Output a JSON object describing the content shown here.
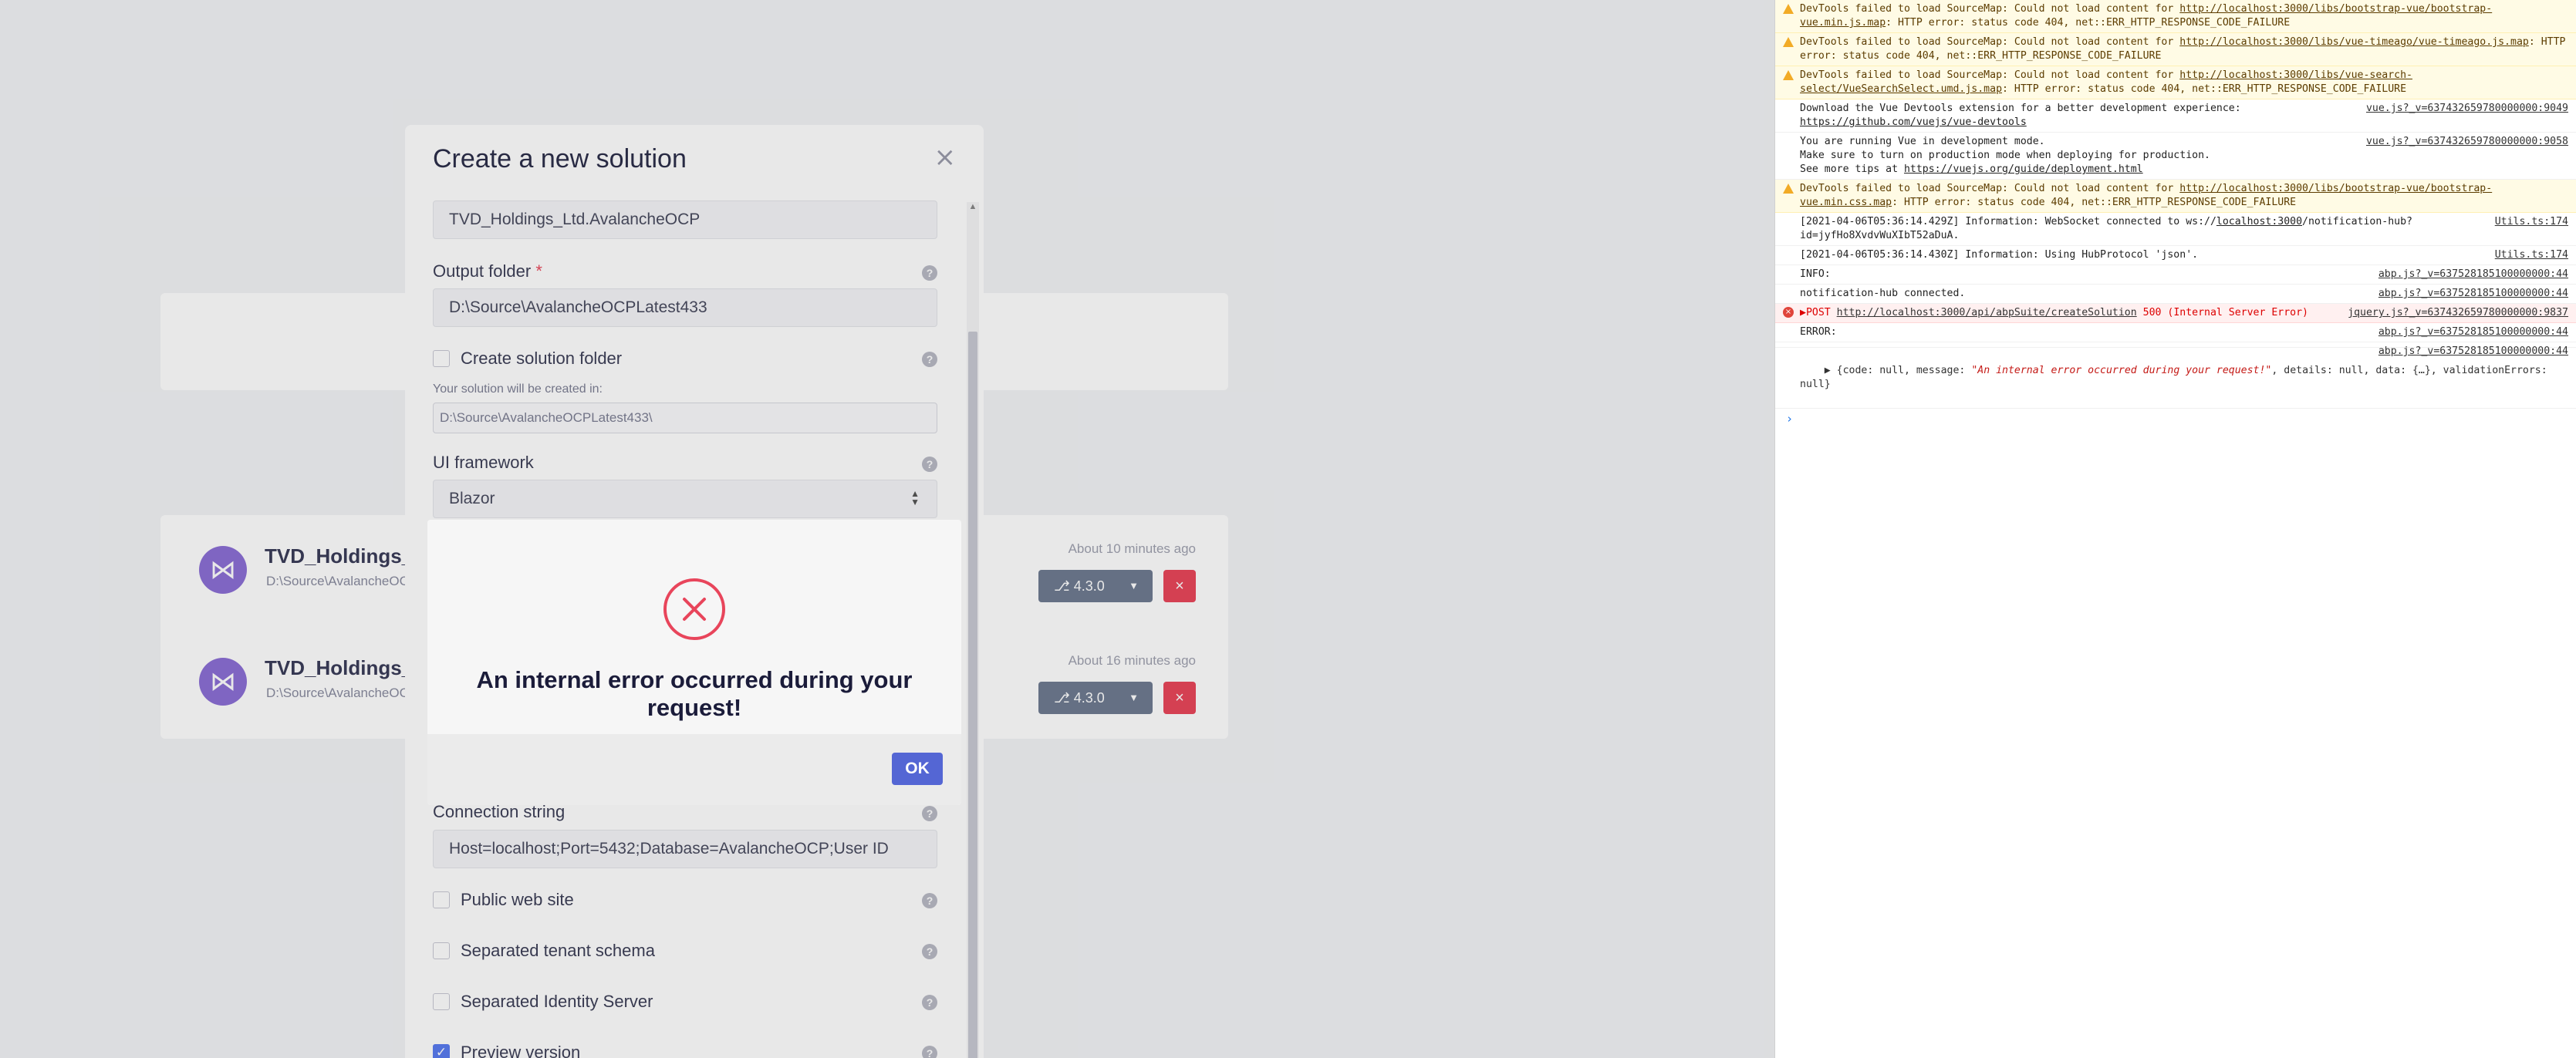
{
  "app": {
    "solutions": [
      {
        "name": "TVD_Holdings_L",
        "path": "D:\\Source\\AvalancheOC",
        "time": "About 10 minutes ago",
        "version": "4.3.0"
      },
      {
        "name": "TVD_Holdings_L",
        "path": "D:\\Source\\AvalancheOC",
        "time": "About 16 minutes ago",
        "version": "4.3.0"
      }
    ],
    "create_modal": {
      "title": "Create a new solution",
      "close": "×",
      "solution_name_value": "TVD_Holdings_Ltd.AvalancheOCP",
      "output_folder_label": "Output folder",
      "required_mark": "*",
      "output_folder_value": "D:\\Source\\AvalancheOCPLatest433",
      "create_solution_folder_label": "Create solution folder",
      "created_in_hint": "Your solution will be created in:",
      "created_in_path": "D:\\Source\\AvalancheOCPLatest433\\",
      "ui_framework_label": "UI framework",
      "ui_framework_value": "Blazor",
      "connection_string_label": "Connection string",
      "connection_string_value": "Host=localhost;Port=5432;Database=AvalancheOCP;User ID",
      "public_web_site_label": "Public web site",
      "separated_tenant_schema_label": "Separated tenant schema",
      "separated_identity_server_label": "Separated Identity Server",
      "preview_version_label": "Preview version",
      "help": "?"
    },
    "error_dialog": {
      "message": "An internal error occurred during your request!",
      "ok_label": "OK"
    }
  },
  "console": {
    "messages": [
      {
        "level": "warn",
        "text": "DevTools failed to load SourceMap: Could not load content for ",
        "link": "http://localhost:3000/libs/bootstrap-vue/bootstrap-vue.min.js.map",
        "tail": ": HTTP error: status code 404, net::ERR_HTTP_RESPONSE_CODE_FAILURE",
        "src": ""
      },
      {
        "level": "warn",
        "text": "DevTools failed to load SourceMap: Could not load content for ",
        "link": "http://localhost:3000/libs/vue-timeago/vue-timeago.js.map",
        "tail": ": HTTP error: status code 404, net::ERR_HTTP_RESPONSE_CODE_FAILURE",
        "src": ""
      },
      {
        "level": "warn",
        "text": "DevTools failed to load SourceMap: Could not load content for ",
        "link": "http://localhost:3000/libs/vue-search-select/VueSearchSelect.umd.js.map",
        "tail": ": HTTP error: status code 404, net::ERR_HTTP_RESPONSE_CODE_FAILURE",
        "src": ""
      },
      {
        "level": "info",
        "text": "Download the Vue Devtools extension for a better development experience:\n",
        "link": "https://github.com/vuejs/vue-devtools",
        "tail": "",
        "src": "vue.js?_v=637432659780000000:9049"
      },
      {
        "level": "info",
        "text": "You are running Vue in development mode.\nMake sure to turn on production mode when deploying for production.\nSee more tips at ",
        "link": "https://vuejs.org/guide/deployment.html",
        "tail": "",
        "src": "vue.js?_v=637432659780000000:9058"
      },
      {
        "level": "warn",
        "text": "DevTools failed to load SourceMap: Could not load content for ",
        "link": "http://localhost:3000/libs/bootstrap-vue/bootstrap-vue.min.css.map",
        "tail": ": HTTP error: status code 404, net::ERR_HTTP_RESPONSE_CODE_FAILURE",
        "src": ""
      },
      {
        "level": "info",
        "text": "[2021-04-06T05:36:14.429Z] Information: WebSocket connected to ws://",
        "link": "localhost:3000",
        "tail": "/notification-hub?id=jyfHo8XvdvWuXIbT52aDuA.",
        "src": "Utils.ts:174"
      },
      {
        "level": "info",
        "text": "[2021-04-06T05:36:14.430Z] Information: Using HubProtocol 'json'.",
        "link": "",
        "tail": "",
        "src": "Utils.ts:174"
      },
      {
        "level": "info",
        "text": "INFO:",
        "link": "",
        "tail": "",
        "src": "abp.js?_v=637528185100000000:44"
      },
      {
        "level": "info",
        "text": "notification-hub connected.",
        "link": "",
        "tail": "",
        "src": "abp.js?_v=637528185100000000:44"
      },
      {
        "level": "err",
        "text": "▶POST ",
        "link": "http://localhost:3000/api/abpSuite/createSolution",
        "tail": " 500 (Internal Server Error)",
        "src": "jquery.js?_v=637432659780000000:9837"
      },
      {
        "level": "info",
        "text": "ERROR:",
        "link": "",
        "tail": "",
        "src": "abp.js?_v=637528185100000000:44"
      },
      {
        "level": "info",
        "text": "",
        "link": "",
        "tail": "",
        "src": "abp.js?_v=637528185100000000:44"
      }
    ],
    "object_line": {
      "prefix": "▶ {code: null, message: ",
      "message": "\"An internal error occurred during your request!\"",
      "suffix": ", details: null, data: {…}, validationErrors: null}"
    },
    "prompt": "›"
  }
}
